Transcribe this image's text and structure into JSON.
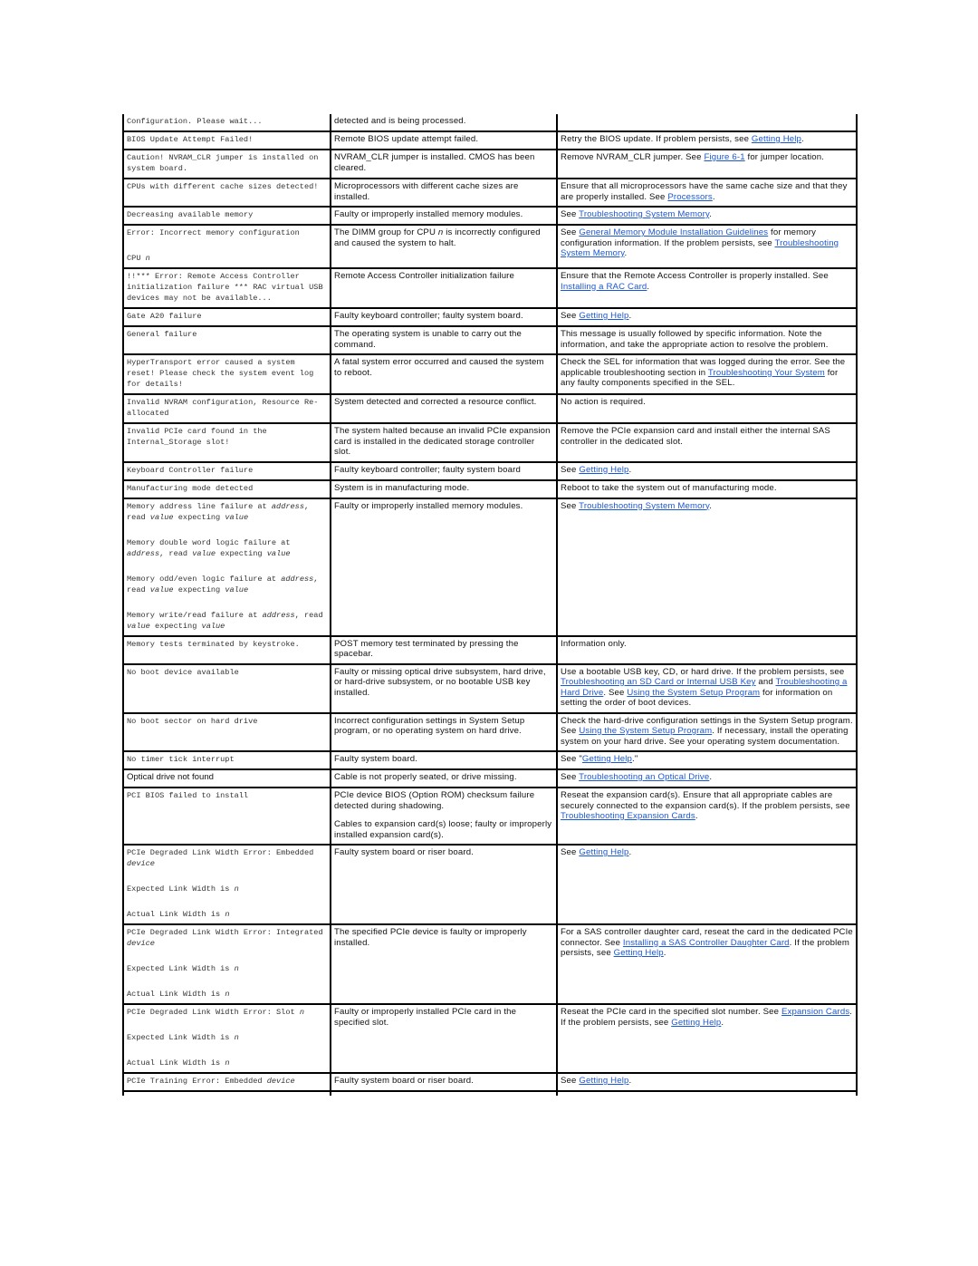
{
  "table": {
    "rows": [
      {
        "message": [
          [
            "Configuration. Please wait..."
          ]
        ],
        "cause": [
          "detected and is being processed."
        ],
        "action": []
      },
      {
        "message": [
          [
            "BIOS Update Attempt Failed!"
          ]
        ],
        "cause": [
          "Remote BIOS update attempt failed."
        ],
        "action": [
          {
            "t": "Retry the BIOS update. If problem persists, see "
          },
          {
            "link": "Getting Help"
          },
          {
            "t": "."
          }
        ]
      },
      {
        "message": [
          [
            "Caution! NVRAM_CLR jumper is installed on system board."
          ]
        ],
        "cause": [
          "NVRAM_CLR jumper is installed. CMOS has been cleared."
        ],
        "action": [
          {
            "t": "Remove NVRAM_CLR jumper. See "
          },
          {
            "link": "Figure 6-1"
          },
          {
            "t": " for jumper location."
          }
        ]
      },
      {
        "message": [
          [
            "CPUs with different cache sizes detected!"
          ]
        ],
        "cause": [
          "Microprocessors with different cache sizes are installed."
        ],
        "action": [
          {
            "t": "Ensure that all microprocessors have the same cache size and that they are properly installed. See "
          },
          {
            "link": "Processors"
          },
          {
            "t": "."
          }
        ]
      },
      {
        "message": [
          [
            "Decreasing available memory"
          ]
        ],
        "cause": [
          "Faulty or improperly installed memory modules."
        ],
        "action": [
          {
            "t": "See "
          },
          {
            "link": "Troubleshooting System Memory"
          },
          {
            "t": "."
          }
        ]
      },
      {
        "message": [
          [
            "Error: Incorrect memory configuration"
          ],
          [
            "CPU ",
            {
              "v": "n"
            }
          ]
        ],
        "cause_rich": [
          {
            "t": "The DIMM group for CPU "
          },
          {
            "v": "n"
          },
          {
            "t": " is incorrectly configured and caused the system to halt."
          }
        ],
        "action": [
          {
            "t": "See "
          },
          {
            "link": "General Memory Module Installation Guidelines"
          },
          {
            "t": " for memory configuration information. If the problem persists, see "
          },
          {
            "link": "Troubleshooting System Memory"
          },
          {
            "t": "."
          }
        ]
      },
      {
        "message": [
          [
            "!!*** Error: Remote Access Controller initialization failure *** RAC virtual USB devices may not be available..."
          ]
        ],
        "cause": [
          "Remote Access Controller initialization failure"
        ],
        "action": [
          {
            "t": "Ensure that the Remote Access Controller is properly installed. See "
          },
          {
            "link": "Installing a RAC Card"
          },
          {
            "t": "."
          }
        ]
      },
      {
        "message": [
          [
            "Gate A20 failure"
          ]
        ],
        "cause": [
          "Faulty keyboard controller; faulty system board."
        ],
        "action": [
          {
            "t": "See "
          },
          {
            "link": "Getting Help"
          },
          {
            "t": "."
          }
        ]
      },
      {
        "message": [
          [
            "General failure"
          ]
        ],
        "cause": [
          "The operating system is unable to carry out the command."
        ],
        "action": [
          {
            "t": "This message is usually followed by specific information. Note the information, and take the appropriate action to resolve the problem."
          }
        ]
      },
      {
        "message": [
          [
            "HyperTransport error caused a system reset! Please check the system event log for details!"
          ]
        ],
        "cause": [
          "A fatal system error occurred and caused the system to reboot."
        ],
        "action": [
          {
            "t": "Check the SEL for information that was logged during the error. See the applicable troubleshooting section in "
          },
          {
            "link": "Troubleshooting Your System"
          },
          {
            "t": " for any faulty components specified in the SEL."
          }
        ]
      },
      {
        "message": [
          [
            "Invalid NVRAM configuration, Resource Re-allocated"
          ]
        ],
        "cause": [
          "System detected and corrected a resource conflict."
        ],
        "action": [
          {
            "t": "No action is required."
          }
        ]
      },
      {
        "message": [
          [
            "Invalid PCIe card found in the Internal_Storage slot!"
          ]
        ],
        "cause": [
          "The system halted because an invalid PCIe expansion card is installed in the dedicated storage controller slot."
        ],
        "action": [
          {
            "t": "Remove the PCIe expansion card and install either the internal SAS controller in the dedicated slot."
          }
        ]
      },
      {
        "message": [
          [
            "Keyboard Controller failure"
          ]
        ],
        "cause": [
          "Faulty keyboard controller; faulty system board"
        ],
        "action": [
          {
            "t": "See "
          },
          {
            "link": "Getting Help"
          },
          {
            "t": "."
          }
        ]
      },
      {
        "message": [
          [
            "Manufacturing mode detected"
          ]
        ],
        "cause": [
          "System is in manufacturing mode."
        ],
        "action": [
          {
            "t": "Reboot to take the system out of manufacturing mode."
          }
        ]
      },
      {
        "message": [
          [
            "Memory address line failure at ",
            {
              "v": "address"
            },
            ", read ",
            {
              "v": "value"
            },
            " expecting ",
            {
              "v": "value"
            }
          ],
          [
            "Memory double word logic failure at ",
            {
              "v": "address"
            },
            ", read ",
            {
              "v": "value"
            },
            " expecting ",
            {
              "v": "value"
            }
          ],
          [
            "Memory odd/even logic failure at ",
            {
              "v": "address"
            },
            ", read ",
            {
              "v": "value"
            },
            " expecting ",
            {
              "v": "value"
            }
          ],
          [
            "Memory write/read failure at ",
            {
              "v": "address"
            },
            ", read ",
            {
              "v": "value"
            },
            " expecting ",
            {
              "v": "value"
            }
          ]
        ],
        "cause": [
          "Faulty or improperly installed memory modules."
        ],
        "action": [
          {
            "t": "See "
          },
          {
            "link": "Troubleshooting System Memory"
          },
          {
            "t": "."
          }
        ]
      },
      {
        "message": [
          [
            "Memory tests terminated by keystroke."
          ]
        ],
        "cause": [
          "POST memory test terminated by pressing the spacebar."
        ],
        "action": [
          {
            "t": "Information only."
          }
        ]
      },
      {
        "message": [
          [
            "No boot device available"
          ]
        ],
        "cause": [
          "Faulty or missing optical drive subsystem, hard drive, or hard-drive subsystem, or no bootable USB key installed."
        ],
        "action": [
          {
            "t": "Use a bootable USB key, CD, or hard drive. If the problem persists, see "
          },
          {
            "link": "Troubleshooting an SD Card or Internal USB Key"
          },
          {
            "t": " and "
          },
          {
            "link": "Troubleshooting a Hard Drive"
          },
          {
            "t": ". See "
          },
          {
            "link": "Using the System Setup Program"
          },
          {
            "t": " for information on setting the order of boot devices."
          }
        ]
      },
      {
        "message": [
          [
            "No boot sector on hard drive"
          ]
        ],
        "cause": [
          "Incorrect configuration settings in System Setup program, or no operating system on hard drive."
        ],
        "action": [
          {
            "t": "Check the hard-drive configuration settings in the System Setup program. See "
          },
          {
            "link": "Using the System Setup Program"
          },
          {
            "t": ". If necessary, install the operating system on your hard drive. See your operating system documentation."
          }
        ]
      },
      {
        "message": [
          [
            "No timer tick interrupt"
          ]
        ],
        "cause": [
          "Faulty system board."
        ],
        "action": [
          {
            "t": "See \""
          },
          {
            "link": "Getting Help"
          },
          {
            "t": ".\""
          }
        ]
      },
      {
        "message": [
          [
            "Optical drive not found"
          ]
        ],
        "message_plain": true,
        "cause": [
          "Cable is not properly seated, or drive missing."
        ],
        "action": [
          {
            "t": "See "
          },
          {
            "link": "Troubleshooting an Optical Drive"
          },
          {
            "t": "."
          }
        ]
      },
      {
        "message": [
          [
            "PCI BIOS failed to install"
          ]
        ],
        "cause": [
          "PCIe device BIOS (Option ROM) checksum failure detected during shadowing.",
          "Cables to expansion card(s) loose; faulty or improperly installed expansion card(s)."
        ],
        "action": [
          {
            "t": "Reseat the expansion card(s). Ensure that all appropriate cables are securely connected to the expansion card(s). If the problem persists, see "
          },
          {
            "link": "Troubleshooting Expansion Cards"
          },
          {
            "t": "."
          }
        ]
      },
      {
        "message": [
          [
            "PCIe Degraded Link Width Error: Embedded ",
            {
              "v": "device"
            }
          ],
          [
            "Expected Link Width is ",
            {
              "v": "n"
            }
          ],
          [
            "Actual Link Width is ",
            {
              "v": "n"
            }
          ]
        ],
        "cause": [
          "Faulty system board or riser board."
        ],
        "action": [
          {
            "t": "See "
          },
          {
            "link": "Getting Help"
          },
          {
            "t": "."
          }
        ]
      },
      {
        "message": [
          [
            "PCIe Degraded Link Width Error: Integrated ",
            {
              "v": "device"
            }
          ],
          [
            "Expected Link Width is ",
            {
              "v": "n"
            }
          ],
          [
            "Actual Link Width is ",
            {
              "v": "n"
            }
          ]
        ],
        "cause": [
          "The specified PCIe device is faulty or improperly installed."
        ],
        "action": [
          {
            "t": "For a SAS controller daughter card, reseat the card in the dedicated PCIe connector. See "
          },
          {
            "link": "Installing a SAS Controller Daughter Card"
          },
          {
            "t": ". If the problem persists, see "
          },
          {
            "link": "Getting Help"
          },
          {
            "t": "."
          }
        ]
      },
      {
        "message": [
          [
            "PCIe Degraded Link Width Error: Slot ",
            {
              "v": "n"
            }
          ],
          [
            "Expected Link Width is ",
            {
              "v": "n"
            }
          ],
          [
            "Actual Link Width is ",
            {
              "v": "n"
            }
          ]
        ],
        "cause": [
          "Faulty or improperly installed PCIe card in the specified slot."
        ],
        "action": [
          {
            "t": "Reseat the PCIe card in the specified slot number. See "
          },
          {
            "link": "Expansion Cards"
          },
          {
            "t": ". If the problem persists, see "
          },
          {
            "link": "Getting Help"
          },
          {
            "t": "."
          }
        ]
      },
      {
        "message": [
          [
            "PCIe Training Error: Embedded ",
            {
              "v": "device"
            }
          ]
        ],
        "cause": [
          "Faulty system board or riser board."
        ],
        "action": [
          {
            "t": "See "
          },
          {
            "link": "Getting Help"
          },
          {
            "t": "."
          }
        ]
      }
    ]
  },
  "colors": {
    "link": "#1a57d6",
    "border": "#000000",
    "message_text": "#333333",
    "body_text": "#111111"
  }
}
